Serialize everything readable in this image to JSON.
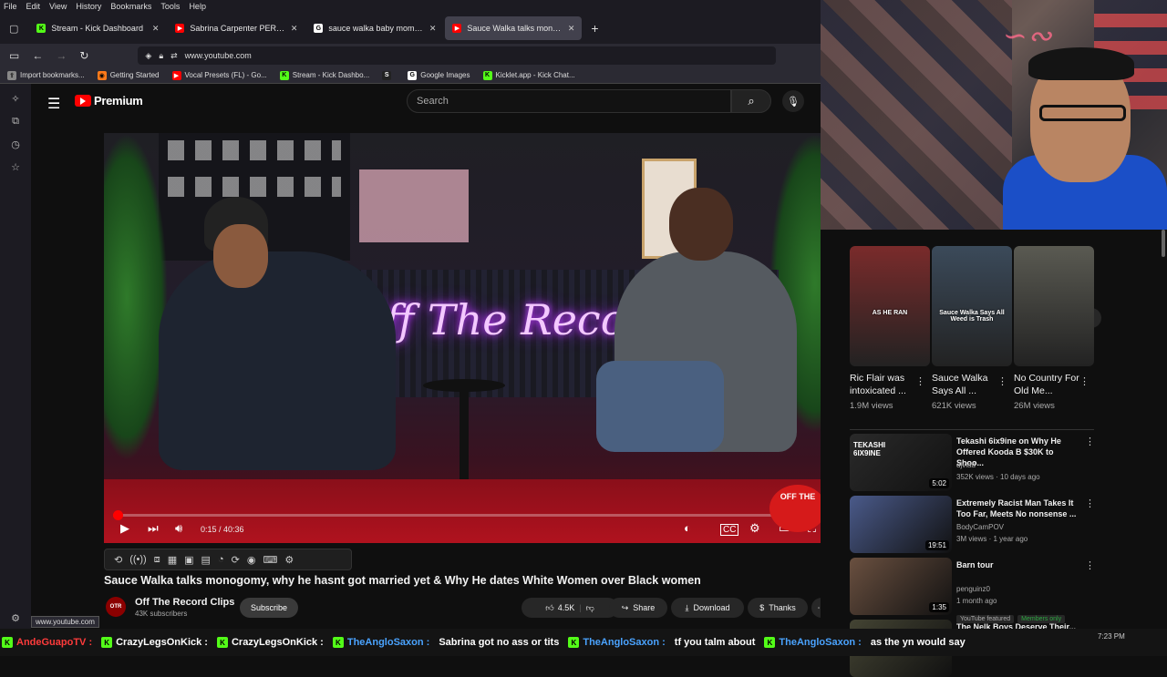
{
  "browser": {
    "menu": [
      "File",
      "Edit",
      "View",
      "History",
      "Bookmarks",
      "Tools",
      "Help"
    ],
    "tabs": [
      {
        "title": "Stream - Kick Dashboard",
        "favicon": "kick-icon",
        "active": false
      },
      {
        "title": "Sabrina Carpenter PERFORMS F",
        "favicon": "youtube-icon",
        "active": false
      },
      {
        "title": "sauce walka baby momma - Go",
        "favicon": "google-icon",
        "active": false
      },
      {
        "title": "Sauce Walka talks monogo",
        "favicon": "youtube-icon",
        "active": true
      }
    ],
    "url": "www.youtube.com",
    "bookmarks": [
      {
        "label": "Import bookmarks...",
        "icon": "import-icon"
      },
      {
        "label": "Getting Started",
        "icon": "firefox-icon"
      },
      {
        "label": "Vocal Presets (FL) - Go...",
        "icon": "youtube-icon"
      },
      {
        "label": "Stream - Kick Dashbo...",
        "icon": "kick-icon"
      },
      {
        "label": "",
        "icon": "s-icon"
      },
      {
        "label": "Google Images",
        "icon": "google-icon"
      },
      {
        "label": "Kicklet.app - Kick Chat...",
        "icon": "kicklet-icon"
      }
    ],
    "status_url": "www.youtube.com"
  },
  "youtube": {
    "logo_text": "Premium",
    "search_placeholder": "Search",
    "video": {
      "neon_text": "Off The Record",
      "time": "0:15 / 40:36",
      "progress": 0.006,
      "badge_text": "OFF THE"
    },
    "title": "Sauce Walka talks monogomy, why he hasnt got married yet & Why He dates White Women over Black women",
    "channel": {
      "name": "Off The Record Clips",
      "subs": "43K subscribers",
      "avatar_text": "OTR"
    },
    "subscribe_label": "Subscribe",
    "actions": {
      "likes": "4.5K",
      "share": "Share",
      "download": "Download",
      "thanks": "Thanks"
    },
    "shorts": [
      {
        "title": "Ric Flair was intoxicated ...",
        "views": "1.9M views",
        "overlay": "AS HE RAN",
        "color": "#7a2b2b"
      },
      {
        "title": "Sauce Walka Says All ...",
        "views": "621K views",
        "overlay": "Sauce Walka Says All Weed is Trash",
        "color": "#3b4a5a"
      },
      {
        "title": "No Country For Old Me...",
        "views": "26M views",
        "overlay": "",
        "color": "#5a5a52"
      }
    ],
    "related": [
      {
        "title": "Tekashi 6ix9ine on Why He Offered Kooda B $30K to Shoo...",
        "channel": "djvlad",
        "meta": "352K views · 10 days ago",
        "duration": "5:02",
        "thumb_text": "TEKASHI 6IX9INE",
        "color": "#2a2a2a"
      },
      {
        "title": "Extremely Racist Man Takes It Too Far, Meets No nonsense ...",
        "channel": "BodyCamPOV",
        "meta": "3M views · 1 year ago",
        "duration": "19:51",
        "thumb_text": "",
        "color": "#4a5a8a"
      },
      {
        "title": "Barn tour",
        "channel": "penguinz0",
        "meta": "1 month ago",
        "duration": "1:35",
        "thumb_text": "",
        "color": "#6a5040",
        "badges": [
          "YouTube featured",
          "Members only"
        ]
      },
      {
        "title": "The Nelk Boys Deserve Their...",
        "channel": "",
        "meta": "",
        "duration": "",
        "thumb_text": "",
        "color": "#443"
      }
    ]
  },
  "ticker": {
    "items": [
      {
        "text": "AndeGuapoTV :",
        "color": "#ff3b3b"
      },
      {
        "text": "CrazyLegsOnKick :",
        "color": "#ffffff"
      },
      {
        "text": "CrazyLegsOnKick :",
        "color": "#ffffff"
      },
      {
        "text": "TheAngloSaxon :",
        "color": "#4aa3ff"
      },
      {
        "text": "Sabrina got no ass or tits",
        "color": "#ffffff"
      },
      {
        "text": "TheAngloSaxon :",
        "color": "#4aa3ff"
      },
      {
        "text": "tf you talm about",
        "color": "#ffffff"
      },
      {
        "text": "TheAngloSaxon :",
        "color": "#4aa3ff"
      },
      {
        "text": "as the yn would say",
        "color": "#ffffff"
      }
    ],
    "clock": "7:23 PM"
  }
}
